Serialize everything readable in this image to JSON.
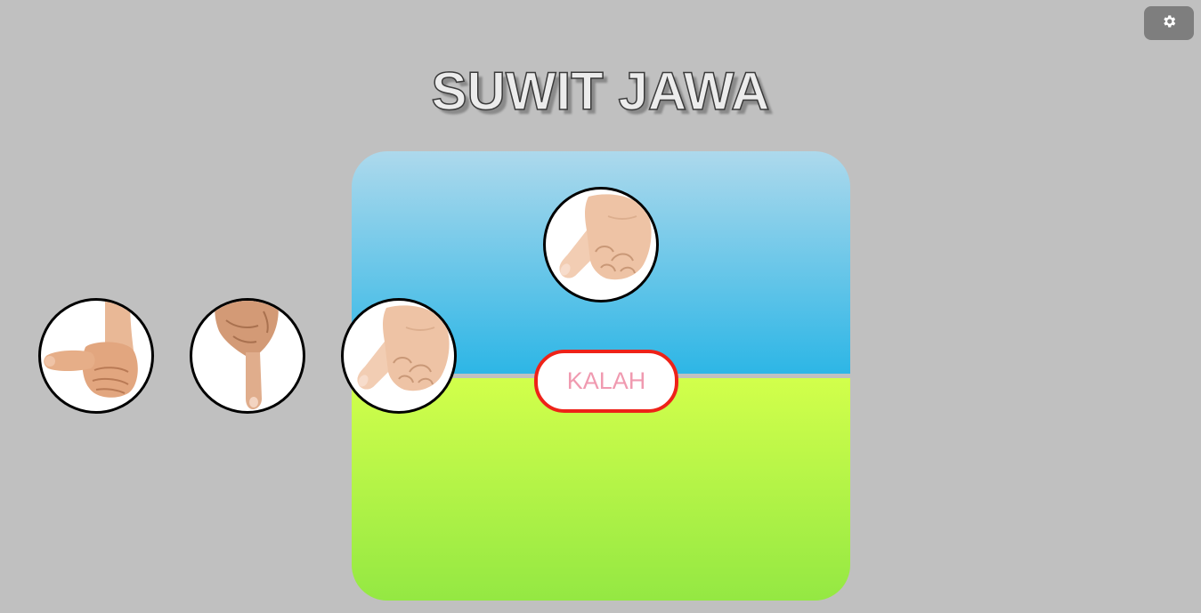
{
  "app": {
    "title": "SUWIT JAWA"
  },
  "settings": {
    "icon": "gear-icon"
  },
  "computer": {
    "choice": "pinky",
    "icon": "pinky-hand-icon"
  },
  "result": {
    "label": "KALAH",
    "border_color": "#ee2218",
    "text_color": "#f09ab0"
  },
  "player": {
    "options": [
      {
        "id": "thumb",
        "icon": "thumb-hand-icon"
      },
      {
        "id": "index",
        "icon": "index-finger-hand-icon"
      },
      {
        "id": "pinky",
        "icon": "pinky-hand-icon"
      }
    ]
  },
  "colors": {
    "background": "#c0c0c0",
    "cpu_area_top": "#add9ec",
    "cpu_area_bottom": "#2db6e6",
    "player_area_top": "#d2ff4b",
    "player_area_bottom": "#94e843"
  }
}
